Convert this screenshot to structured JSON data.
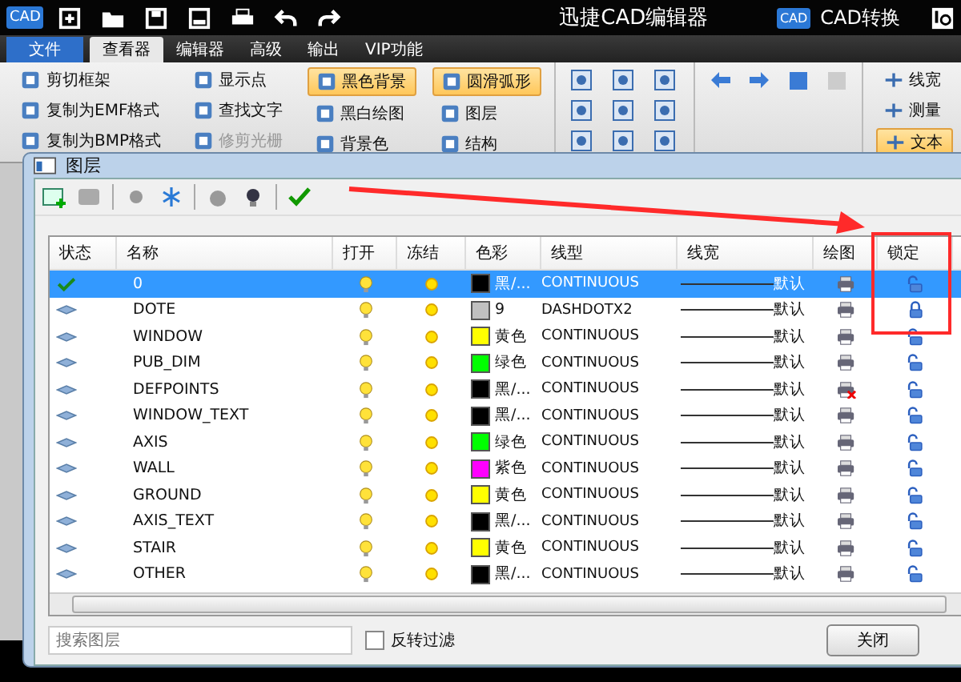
{
  "app_bar": {
    "logo": "CAD",
    "title": "迅捷CAD编辑器",
    "convert_logo": "CAD",
    "convert_label": "CAD转换"
  },
  "menu_tabs": [
    {
      "label": "文件",
      "kind": "file",
      "selected": false
    },
    {
      "label": "查看器",
      "kind": "tab",
      "selected": true
    },
    {
      "label": "编辑器",
      "kind": "tab",
      "selected": false
    },
    {
      "label": "高级",
      "kind": "tab",
      "selected": false
    },
    {
      "label": "输出",
      "kind": "tab",
      "selected": false
    },
    {
      "label": "VIP功能",
      "kind": "tab",
      "selected": false
    }
  ],
  "ribbon": {
    "text_columns": [
      [
        {
          "label": "剪切框架",
          "selected": false,
          "disabled": false
        },
        {
          "label": "复制为EMF格式",
          "selected": false,
          "disabled": false
        },
        {
          "label": "复制为BMP格式",
          "selected": false,
          "disabled": false
        }
      ],
      [
        {
          "label": "显示点",
          "selected": false,
          "disabled": false
        },
        {
          "label": "查找文字",
          "selected": false,
          "disabled": false
        },
        {
          "label": "修剪光栅",
          "selected": false,
          "disabled": true
        }
      ],
      [
        {
          "label": "黑色背景",
          "selected": true,
          "disabled": false
        },
        {
          "label": "黑白绘图",
          "selected": false,
          "disabled": false
        },
        {
          "label": "背景色",
          "selected": false,
          "disabled": false
        }
      ],
      [
        {
          "label": "圆滑弧形",
          "selected": true,
          "disabled": false
        },
        {
          "label": "图层",
          "selected": false,
          "disabled": false
        },
        {
          "label": "结构",
          "selected": false,
          "disabled": false
        }
      ]
    ],
    "right_column": [
      {
        "label": "线宽",
        "selected": false
      },
      {
        "label": "测量",
        "selected": false
      },
      {
        "label": "文本",
        "selected": true
      }
    ]
  },
  "dialog": {
    "title": "图层",
    "columns": [
      "状态",
      "名称",
      "打开",
      "冻结",
      "色彩",
      "线型",
      "线宽",
      "绘图",
      "锁定"
    ],
    "rows": [
      {
        "current": true,
        "selected": true,
        "name": "0",
        "on": true,
        "frozen": false,
        "color": "#000000",
        "color_label": "黑/...",
        "linetype": "CONTINUOUS",
        "lineweight": "默认",
        "plot": true,
        "locked": false
      },
      {
        "current": false,
        "selected": false,
        "name": "DOTE",
        "on": true,
        "frozen": false,
        "color": "#c0c0c0",
        "color_label": "9",
        "linetype": "DASHDOTX2",
        "lineweight": "默认",
        "plot": true,
        "locked": true
      },
      {
        "current": false,
        "selected": false,
        "name": "WINDOW",
        "on": true,
        "frozen": false,
        "color": "#ffff00",
        "color_label": "黄色",
        "linetype": "CONTINUOUS",
        "lineweight": "默认",
        "plot": true,
        "locked": false
      },
      {
        "current": false,
        "selected": false,
        "name": "PUB_DIM",
        "on": true,
        "frozen": false,
        "color": "#00ff00",
        "color_label": "绿色",
        "linetype": "CONTINUOUS",
        "lineweight": "默认",
        "plot": true,
        "locked": false
      },
      {
        "current": false,
        "selected": false,
        "name": "DEFPOINTS",
        "on": true,
        "frozen": false,
        "color": "#000000",
        "color_label": "黑/...",
        "linetype": "CONTINUOUS",
        "lineweight": "默认",
        "plot": false,
        "locked": false
      },
      {
        "current": false,
        "selected": false,
        "name": "WINDOW_TEXT",
        "on": true,
        "frozen": false,
        "color": "#000000",
        "color_label": "黑/...",
        "linetype": "CONTINUOUS",
        "lineweight": "默认",
        "plot": true,
        "locked": false
      },
      {
        "current": false,
        "selected": false,
        "name": "AXIS",
        "on": true,
        "frozen": false,
        "color": "#00ff00",
        "color_label": "绿色",
        "linetype": "CONTINUOUS",
        "lineweight": "默认",
        "plot": true,
        "locked": false
      },
      {
        "current": false,
        "selected": false,
        "name": "WALL",
        "on": true,
        "frozen": false,
        "color": "#ff00ff",
        "color_label": "紫色",
        "linetype": "CONTINUOUS",
        "lineweight": "默认",
        "plot": true,
        "locked": false
      },
      {
        "current": false,
        "selected": false,
        "name": "GROUND",
        "on": true,
        "frozen": false,
        "color": "#ffff00",
        "color_label": "黄色",
        "linetype": "CONTINUOUS",
        "lineweight": "默认",
        "plot": true,
        "locked": false
      },
      {
        "current": false,
        "selected": false,
        "name": "AXIS_TEXT",
        "on": true,
        "frozen": false,
        "color": "#000000",
        "color_label": "黑/...",
        "linetype": "CONTINUOUS",
        "lineweight": "默认",
        "plot": true,
        "locked": false
      },
      {
        "current": false,
        "selected": false,
        "name": "STAIR",
        "on": true,
        "frozen": false,
        "color": "#ffff00",
        "color_label": "黄色",
        "linetype": "CONTINUOUS",
        "lineweight": "默认",
        "plot": true,
        "locked": false
      },
      {
        "current": false,
        "selected": false,
        "name": "OTHER",
        "on": true,
        "frozen": false,
        "color": "#000000",
        "color_label": "黑/...",
        "linetype": "CONTINUOUS",
        "lineweight": "默认",
        "plot": true,
        "locked": false
      }
    ],
    "search": {
      "placeholder": "搜索图层"
    },
    "invert_filter": {
      "label": "反转过滤",
      "checked": false
    },
    "close_button": "关闭"
  }
}
